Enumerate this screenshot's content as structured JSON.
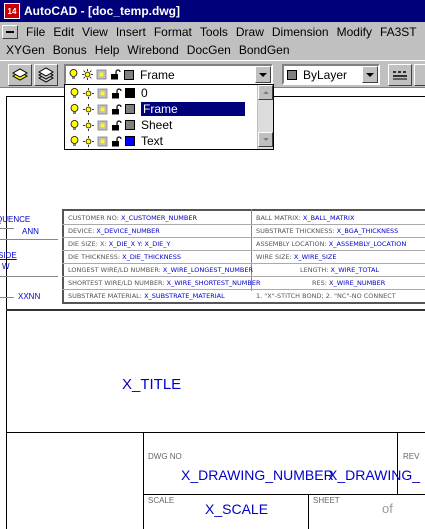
{
  "window": {
    "title": "AutoCAD - [doc_temp.dwg]",
    "app_icon_label": "14"
  },
  "menu": {
    "row1": [
      "File",
      "Edit",
      "View",
      "Insert",
      "Format",
      "Tools",
      "Draw",
      "Dimension",
      "Modify",
      "FA3ST"
    ],
    "row2": [
      "XYGen",
      "Bonus",
      "Help",
      "Wirebond",
      "DocGen",
      "BondGen"
    ]
  },
  "toolbar": {
    "current_layer": "Frame",
    "color_value": "ByLayer"
  },
  "layer_dropdown": {
    "items": [
      {
        "name": "0",
        "color": "#000000"
      },
      {
        "name": "Frame",
        "color": "#808080"
      },
      {
        "name": "Sheet",
        "color": "#808080"
      },
      {
        "name": "Text",
        "color": "#0000ff"
      }
    ],
    "selected_index": 1
  },
  "left_labels": {
    "sequence": "QUENCE",
    "ann": "ANN",
    "side": "SIDE",
    "w": "W",
    "xxnn": "XXNN"
  },
  "info_table": {
    "rows": [
      {
        "l_label": "CUSTOMER NO:",
        "l_value": "X_CUSTOMER_NUMBER",
        "r_label": "BALL MATRIX:",
        "r_value": "X_BALL_MATRIX"
      },
      {
        "l_label": "DEVICE:",
        "l_value": "X_DEVICE_NUMBER",
        "r_label": "SUBSTRATE THICKNESS:",
        "r_value": "X_BGA_THICKNESS"
      },
      {
        "l_label": "DIE SIZE: X:",
        "l_value": "X_DIE_X  Y: X_DIE_Y",
        "r_label": "ASSEMBLY LOCATION:",
        "r_value": "X_ASSEMBLY_LOCATION"
      },
      {
        "l_label": "DIE THICKNESS:",
        "l_value": "X_DIE_THICKNESS",
        "r_label": "WIRE SIZE:",
        "r_value": "X_WIRE_SIZE"
      },
      {
        "l_label": "LONGEST WIRE/LD NUMBER:",
        "l_value": "X_WIRE_LONGEST_NUMBER",
        "r_label": "LENGTH:",
        "r_value": "X_WIRE_TOTAL"
      },
      {
        "l_label": "SHORTEST WIRE/LD NUMBER:",
        "l_value": "X_WIRE_SHORTEST_NUMBER",
        "r_label": "RES:",
        "r_value": "X_WIRE_NUMBER"
      },
      {
        "l_label": "SUBSTRATE MATERIAL:",
        "l_value": "X_SUBSTRATE_MATERIAL",
        "r_label": "1. \"X\"-STITCH BOND; 2. \"NC\"-NO CONNECT",
        "r_value": ""
      }
    ]
  },
  "title_block": {
    "title": "X_TITLE",
    "dwg_no_label": "DWG NO",
    "drawing_number": "X_DRAWING_NUMBER",
    "drawing_number_overlap": "X_DRAWING_",
    "rev_label": "REV",
    "scale_label": "SCALE",
    "scale_value": "X_SCALE",
    "sheet_label": "SHEET",
    "of_text": "of"
  }
}
